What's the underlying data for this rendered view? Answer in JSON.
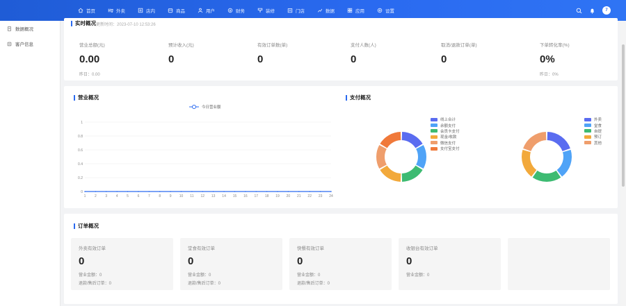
{
  "topnav": {
    "items": [
      {
        "label": "首页",
        "icon": "home-icon"
      },
      {
        "label": "外卖",
        "icon": "takeout-icon"
      },
      {
        "label": "店内",
        "icon": "store-inside-icon"
      },
      {
        "label": "商品",
        "icon": "goods-icon"
      },
      {
        "label": "用户",
        "icon": "user-icon"
      },
      {
        "label": "财务",
        "icon": "finance-icon"
      },
      {
        "label": "装修",
        "icon": "decorate-icon"
      },
      {
        "label": "门店",
        "icon": "shop-icon"
      },
      {
        "label": "数据",
        "icon": "chart-icon"
      },
      {
        "label": "应用",
        "icon": "apps-icon"
      },
      {
        "label": "设置",
        "icon": "settings-icon"
      }
    ],
    "avatar_text": "7"
  },
  "sidebar": {
    "items": [
      {
        "label": "数据概况"
      },
      {
        "label": "客户信息"
      }
    ]
  },
  "realtime": {
    "title": "实时概况",
    "update_time": "更新时间：2023-07-10 12:53:26",
    "stats": [
      {
        "label": "营业总额(元)",
        "value": "0.00",
        "sub": "昨日：0.00"
      },
      {
        "label": "预计收入(元)",
        "value": "0",
        "sub": ""
      },
      {
        "label": "有效订单数(单)",
        "value": "0",
        "sub": ""
      },
      {
        "label": "支付人数(人)",
        "value": "0",
        "sub": ""
      },
      {
        "label": "取消/退款订单(单)",
        "value": "0",
        "sub": ""
      },
      {
        "label": "下单转化率(%)",
        "value": "0%",
        "sub": "昨日：0%"
      }
    ]
  },
  "overview": {
    "title": "营业概况",
    "pay_title": "支付概况"
  },
  "chart_data": [
    {
      "type": "line",
      "title": "营业概况",
      "series": [
        {
          "name": "今日营业额",
          "values": [
            0,
            0,
            0,
            0,
            0,
            0,
            0,
            0,
            0,
            0,
            0,
            0,
            0,
            0,
            0,
            0,
            0,
            0,
            0,
            0,
            0,
            0,
            0,
            0
          ]
        }
      ],
      "x": [
        1,
        2,
        3,
        4,
        5,
        6,
        7,
        8,
        9,
        10,
        11,
        12,
        13,
        14,
        15,
        16,
        17,
        18,
        19,
        20,
        21,
        22,
        23,
        24
      ],
      "yticks": [
        "0",
        "0.2",
        "0.4",
        "0.6",
        "0.8",
        "1"
      ],
      "ylim": [
        0,
        1
      ],
      "grid": true,
      "legend": "top-center",
      "color": "#2a6af0"
    },
    {
      "type": "pie",
      "title": "支付概况",
      "categories": [
        "线上合计",
        "余额支付",
        "会员卡支付",
        "现金/收款",
        "微信支付",
        "支付宝支付"
      ],
      "values": [
        1,
        1,
        1,
        1,
        1,
        1
      ],
      "colors": [
        "#5a6cf0",
        "#4fa3f7",
        "#3dbb72",
        "#f2a93b",
        "#ef9e6c",
        "#f0793a"
      ],
      "legend": "right"
    },
    {
      "type": "pie",
      "categories": [
        "外卖",
        "堂食",
        "自提",
        "预订",
        "其他"
      ],
      "values": [
        1,
        1,
        1,
        1,
        1
      ],
      "colors": [
        "#5a6cf0",
        "#4fa3f7",
        "#3dbb72",
        "#f2a93b",
        "#ef9e6c"
      ],
      "legend": "right"
    }
  ],
  "orders": {
    "title": "订单概况",
    "boxes": [
      {
        "label": "外卖有效订单",
        "value": "0",
        "sub": "营业金额：0",
        "sub2": "退款/售后订单：0"
      },
      {
        "label": "堂食有效订单",
        "value": "0",
        "sub": "营业金额：0",
        "sub2": "退款/售后订单：0"
      },
      {
        "label": "快餐有效订单",
        "value": "0",
        "sub": "营业金额：0",
        "sub2": "退款/售后订单：0"
      },
      {
        "label": "收银台有效订单",
        "value": "0",
        "sub": "营业金额：0",
        "sub2": ""
      },
      {
        "label": "",
        "value": "",
        "sub": "",
        "sub2": ""
      }
    ]
  }
}
